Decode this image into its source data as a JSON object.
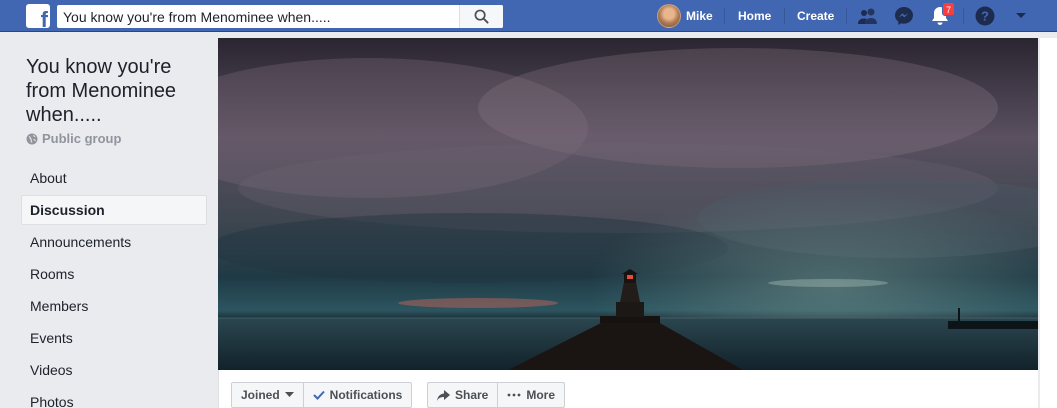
{
  "topbar": {
    "search_value": "You know you're from Menominee when.....",
    "user_name": "Mike",
    "home_label": "Home",
    "create_label": "Create",
    "notifications_count": "7",
    "brand_color": "#4267b2"
  },
  "sidebar": {
    "group_title": "You know you're from Menominee when.....",
    "privacy_label": "Public group",
    "items": [
      {
        "label": "About"
      },
      {
        "label": "Discussion"
      },
      {
        "label": "Announcements"
      },
      {
        "label": "Rooms"
      },
      {
        "label": "Members"
      },
      {
        "label": "Events"
      },
      {
        "label": "Videos"
      },
      {
        "label": "Photos"
      }
    ]
  },
  "actions": {
    "joined_label": "Joined",
    "notifications_label": "Notifications",
    "share_label": "Share",
    "more_label": "More"
  }
}
